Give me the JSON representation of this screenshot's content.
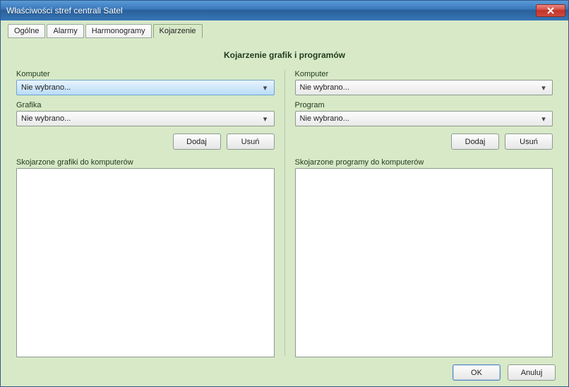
{
  "window": {
    "title": "Właściwości stref centrali Satel"
  },
  "tabs": [
    {
      "label": "Ogólne"
    },
    {
      "label": "Alarmy"
    },
    {
      "label": "Harmonogramy"
    },
    {
      "label": "Kojarzenie"
    }
  ],
  "section_title": "Kojarzenie grafik i programów",
  "left": {
    "computer_label": "Komputer",
    "computer_value": "Nie wybrano...",
    "graphic_label": "Grafika",
    "graphic_value": "Nie wybrano...",
    "add_label": "Dodaj",
    "remove_label": "Usuń",
    "list_label": "Skojarzone grafiki do komputerów"
  },
  "right": {
    "computer_label": "Komputer",
    "computer_value": "Nie wybrano...",
    "program_label": "Program",
    "program_value": "Nie wybrano...",
    "add_label": "Dodaj",
    "remove_label": "Usuń",
    "list_label": "Skojarzone programy do komputerów"
  },
  "footer": {
    "ok": "OK",
    "cancel": "Anuluj"
  }
}
